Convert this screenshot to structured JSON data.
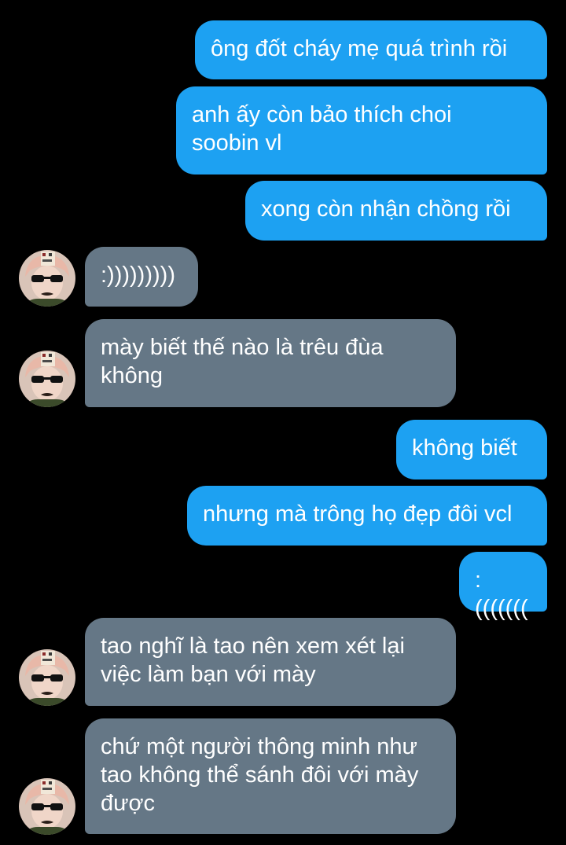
{
  "colors": {
    "background": "#000000",
    "sent_bubble": "#1da1f2",
    "received_bubble": "#657786",
    "text": "#ffffff"
  },
  "messages": [
    {
      "direction": "sent",
      "text": "ông đốt cháy mẹ quá trình rồi"
    },
    {
      "direction": "sent",
      "text": "anh ấy còn bảo thích choi\nsoobin vl"
    },
    {
      "direction": "sent",
      "text": "xong còn nhận chồng rồi"
    },
    {
      "direction": "received",
      "text": ":)))))))))"
    },
    {
      "direction": "received",
      "text": "mày biết thế nào là trêu đùa\nkhông"
    },
    {
      "direction": "sent",
      "text": "không biết"
    },
    {
      "direction": "sent",
      "text": "nhưng mà trông họ đẹp đôi vcl"
    },
    {
      "direction": "sent",
      "text": ":((((((("
    },
    {
      "direction": "received",
      "text": "tao nghĩ là tao nên xem xét lại\nviệc làm bạn với mày"
    },
    {
      "direction": "received",
      "text": "chứ một người thông minh như\ntao không thể sánh đôi với mày\nđược"
    }
  ],
  "avatar": {
    "icon": "user-avatar-sunglasses"
  }
}
